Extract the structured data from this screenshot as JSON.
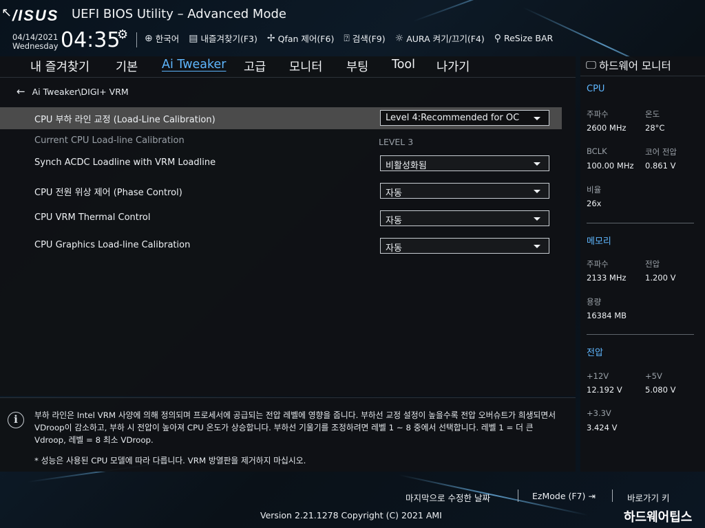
{
  "header": {
    "logo": "/ISUS",
    "title": "UEFI BIOS Utility – Advanced Mode",
    "date": "04/14/2021",
    "weekday": "Wednesday",
    "time": "04:35",
    "toolbar": [
      {
        "icon": "globe-icon",
        "label": "한국어"
      },
      {
        "icon": "favorites-icon",
        "label": "내즐겨찾기(F3)"
      },
      {
        "icon": "fan-icon",
        "label": "Qfan 제어(F6)"
      },
      {
        "icon": "help-search-icon",
        "label": "검색(F9)"
      },
      {
        "icon": "aura-icon",
        "label": "AURA 켜기/끄기(F4)"
      },
      {
        "icon": "resize-bar-icon",
        "label": "ReSize BAR"
      }
    ]
  },
  "tabs": [
    {
      "label": "내 즐겨찾기"
    },
    {
      "label": "기본"
    },
    {
      "label": "Ai Tweaker",
      "active": true
    },
    {
      "label": "고급"
    },
    {
      "label": "모니터"
    },
    {
      "label": "부팅"
    },
    {
      "label": "Tool"
    },
    {
      "label": "나가기"
    }
  ],
  "breadcrumb": "Ai Tweaker\\DIGI+ VRM",
  "settings": [
    {
      "label": "CPU 부하 라인 교정 (Load-Line Calibration)",
      "value": "Level 4:Recommended for OC",
      "type": "dropdown",
      "selected": true
    },
    {
      "label": "Current CPU Load-line Calibration",
      "value": "LEVEL 3",
      "type": "readonly"
    },
    {
      "label": "Synch ACDC Loadline with VRM Loadline",
      "value": "비활성화됨",
      "type": "dropdown"
    },
    {
      "label": "CPU 전원 위상 제어 (Phase Control)",
      "value": "자동",
      "type": "dropdown"
    },
    {
      "label": "CPU VRM Thermal Control",
      "value": "자동",
      "type": "dropdown"
    },
    {
      "label": "CPU Graphics Load-line Calibration",
      "value": "자동",
      "type": "dropdown"
    }
  ],
  "help": {
    "text": "부하 라인은 Intel VRM 사양에 의해 정의되며 프로세서에 공급되는 전압 레벨에 영향을 줍니다. 부하선 교정 설정이 높을수록 전압 오버슈트가 희생되면서 VDroop이 감소하고, 부하 시 전압이 높아져 CPU 온도가 상승합니다. 부하선 기울기를 조정하려면 레벨 1 ~ 8 중에서 선택합니다. 레벨 1 = 더 큰 Vdroop, 레벨 = 8 최소 VDroop.",
    "note": "* 성능은 사용된 CPU 모델에 따라 다릅니다. VRM 방열판을 제거하지 마십시오."
  },
  "monitor": {
    "title": "하드웨어 모니터",
    "cpu": {
      "heading": "CPU",
      "freq_label": "주파수",
      "freq": "2600 MHz",
      "temp_label": "온도",
      "temp": "28°C",
      "bclk_label": "BCLK",
      "bclk": "100.00 MHz",
      "core_v_label": "코어 전압",
      "core_v": "0.861 V",
      "ratio_label": "비율",
      "ratio": "26x"
    },
    "memory": {
      "heading": "메모리",
      "freq_label": "주파수",
      "freq": "2133 MHz",
      "volt_label": "전압",
      "volt": "1.200 V",
      "cap_label": "용량",
      "cap": "16384 MB"
    },
    "voltage": {
      "heading": "전압",
      "v12_label": "+12V",
      "v12": "12.192 V",
      "v5_label": "+5V",
      "v5": "5.080 V",
      "v33_label": "+3.3V",
      "v33": "3.424 V"
    }
  },
  "footer": {
    "last_modified": "마지막으로 수정한 날짜",
    "ezmode": "EzMode (F7)",
    "shortcut": "바로가기 키",
    "version": "Version 2.21.1278 Copyright (C) 2021 AMI",
    "watermark": "하드웨어팁스"
  }
}
